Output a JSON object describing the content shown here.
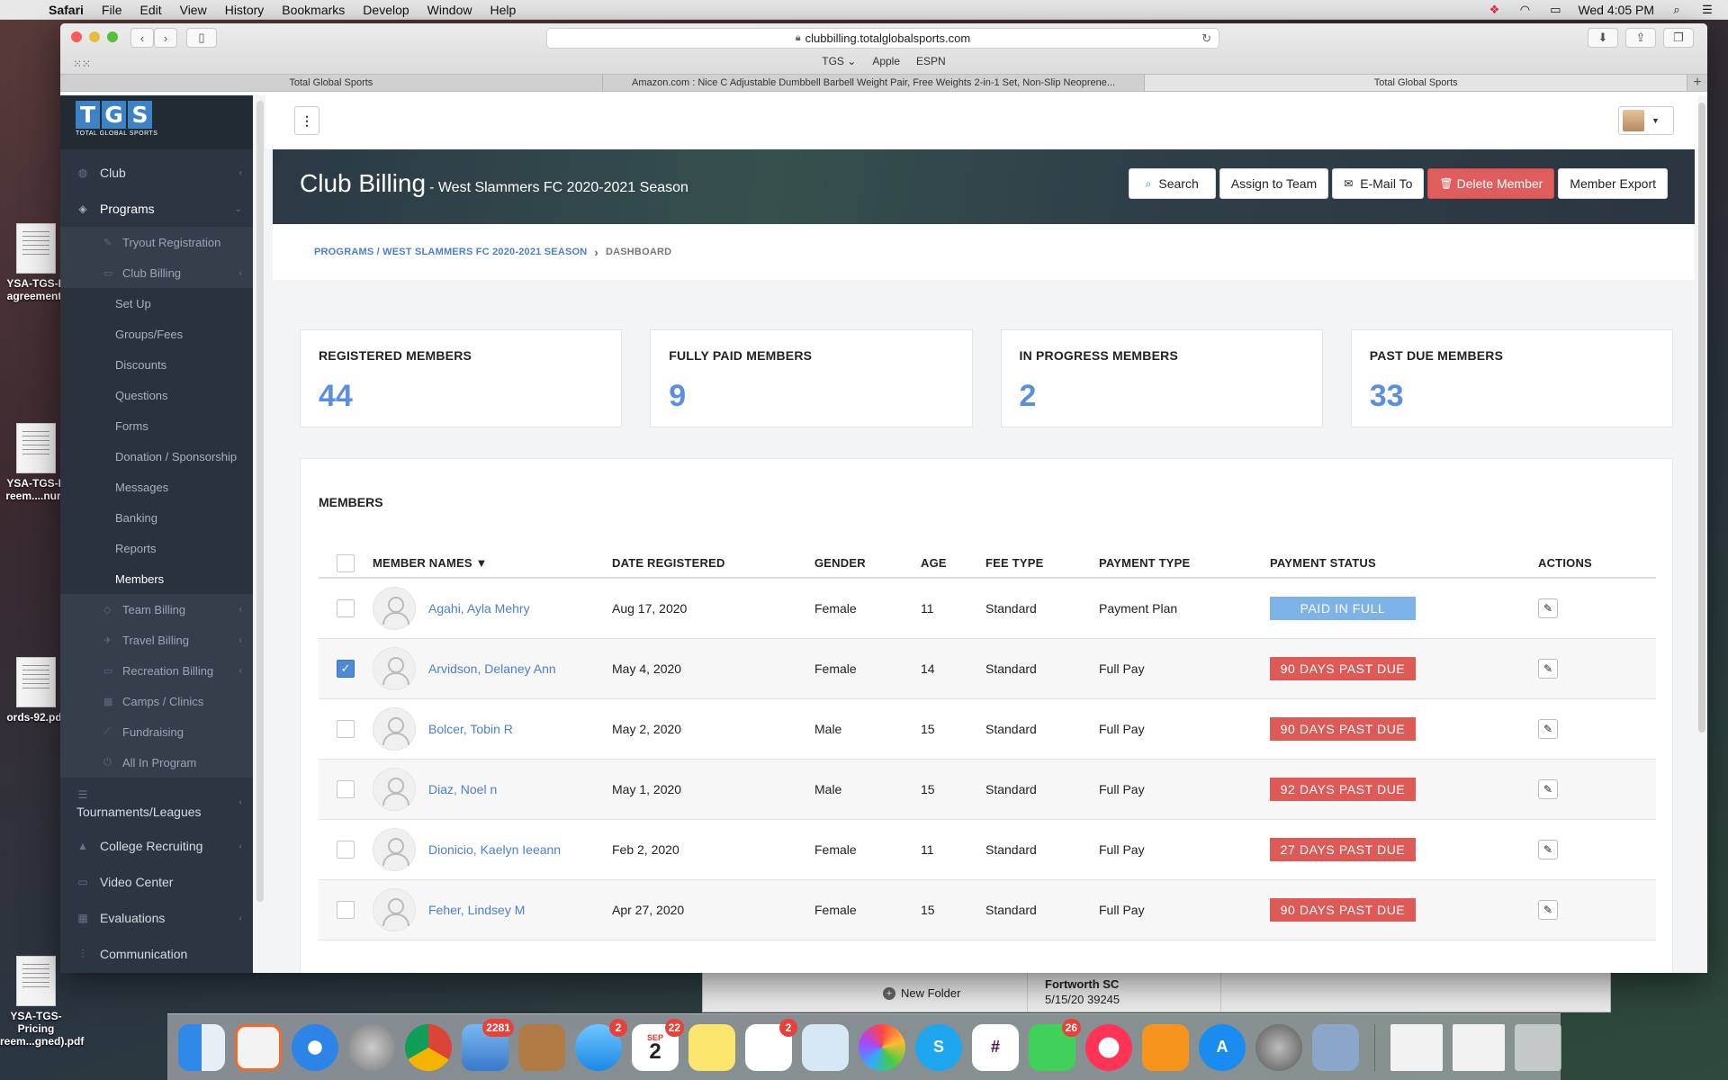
{
  "menubar": {
    "app": "Safari",
    "items": [
      "File",
      "Edit",
      "View",
      "History",
      "Bookmarks",
      "Develop",
      "Window",
      "Help"
    ],
    "clock": "Wed 4:05 PM"
  },
  "desktop": {
    "files": [
      {
        "line1": "YSA-TGS-P",
        "line2": "agreement-"
      },
      {
        "line1": "YSA-TGS-P",
        "line2": "reem....num"
      },
      {
        "line1": "ords-92.pdf",
        "line2": ""
      },
      {
        "line1": "YSA-TGS-Pricing",
        "line2": "reem...gned).pdf"
      }
    ]
  },
  "bg_window": {
    "new_folder": "New Folder",
    "title": "Fortworth SC",
    "detail": "5/15/20  39245"
  },
  "browser": {
    "url": "clubbilling.totalglobalsports.com",
    "favorites": [
      "TGS ⌄",
      "Apple",
      "ESPN"
    ],
    "tabs": [
      "Total Global Sports",
      "Amazon.com : Nice C Adjustable Dumbbell Barbell Weight Pair, Free Weights 2-in-1 Set, Non-Slip Neoprene...",
      "Total Global Sports"
    ]
  },
  "logo": {
    "letters": [
      "T",
      "G",
      "S"
    ],
    "subtitle": "TOTAL GLOBAL SPORTS"
  },
  "sidebar": {
    "club": "Club",
    "programs": "Programs",
    "tryout": "Tryout Registration",
    "club_billing": "Club Billing",
    "club_billing_items": [
      "Set Up",
      "Groups/Fees",
      "Discounts",
      "Questions",
      "Forms",
      "Donation / Sponsorship",
      "Messages",
      "Banking",
      "Reports",
      "Members"
    ],
    "team_billing": "Team Billing",
    "travel_billing": "Travel Billing",
    "recreation_billing": "Recreation Billing",
    "camps": "Camps / Clinics",
    "fundraising": "Fundraising",
    "all_in_program": "All In Program",
    "tournaments": "Tournaments/Leagues",
    "college": "College Recruiting",
    "video": "Video Center",
    "evaluations": "Evaluations",
    "communication": "Communication"
  },
  "header": {
    "title": "Club Billing",
    "subtitle": "- West Slammers FC 2020-2021 Season",
    "search": "Search",
    "assign": "Assign to Team",
    "email": "E-Mail To",
    "delete": "Delete Member",
    "export": "Member Export"
  },
  "breadcrumb": {
    "program": "PROGRAMS / WEST SLAMMERS FC 2020-2021 SEASON",
    "current": "DASHBOARD"
  },
  "stats": [
    {
      "label": "REGISTERED MEMBERS",
      "value": "44"
    },
    {
      "label": "FULLY PAID MEMBERS",
      "value": "9"
    },
    {
      "label": "IN PROGRESS MEMBERS",
      "value": "2"
    },
    {
      "label": "PAST DUE MEMBERS",
      "value": "33"
    }
  ],
  "members": {
    "heading": "MEMBERS",
    "columns": {
      "name": "MEMBER NAMES ▼",
      "date": "DATE REGISTERED",
      "gender": "GENDER",
      "age": "AGE",
      "fee": "FEE TYPE",
      "payment": "PAYMENT TYPE",
      "status": "PAYMENT STATUS",
      "actions": "ACTIONS"
    },
    "rows": [
      {
        "name": "Agahi, Ayla Mehry",
        "date": "Aug 17, 2020",
        "gender": "Female",
        "age": "11",
        "fee": "Standard",
        "payment": "Payment Plan",
        "status": "PAID IN FULL",
        "checked": false
      },
      {
        "name": "Arvidson, Delaney Ann",
        "date": "May 4, 2020",
        "gender": "Female",
        "age": "14",
        "fee": "Standard",
        "payment": "Full Pay",
        "status": "90 DAYS PAST DUE",
        "checked": true
      },
      {
        "name": "Bolcer, Tobin R",
        "date": "May 2, 2020",
        "gender": "Male",
        "age": "15",
        "fee": "Standard",
        "payment": "Full Pay",
        "status": "90 DAYS PAST DUE",
        "checked": false
      },
      {
        "name": "Diaz, Noel n",
        "date": "May 1, 2020",
        "gender": "Male",
        "age": "15",
        "fee": "Standard",
        "payment": "Full Pay",
        "status": "92 DAYS PAST DUE",
        "checked": false
      },
      {
        "name": "Dionicio, Kaelyn Ieeann",
        "date": "Feb 2, 2020",
        "gender": "Female",
        "age": "11",
        "fee": "Standard",
        "payment": "Full Pay",
        "status": "27 DAYS PAST DUE",
        "checked": false
      },
      {
        "name": "Feher, Lindsey M",
        "date": "Apr 27, 2020",
        "gender": "Female",
        "age": "15",
        "fee": "Standard",
        "payment": "Full Pay",
        "status": "90 DAYS PAST DUE",
        "checked": false
      }
    ]
  },
  "dock": {
    "badges": {
      "mail": "2281",
      "messages": "2",
      "calendar_day": "2",
      "calendar_month": "SEP",
      "calendar": "22",
      "reminders": "2",
      "facetime": "26"
    }
  },
  "colors": {
    "accent": "#4a7fd6",
    "paid": "#7db3e8",
    "due": "#dd5a56",
    "danger": "#e05d5d",
    "sidebar": "#2c3542"
  }
}
